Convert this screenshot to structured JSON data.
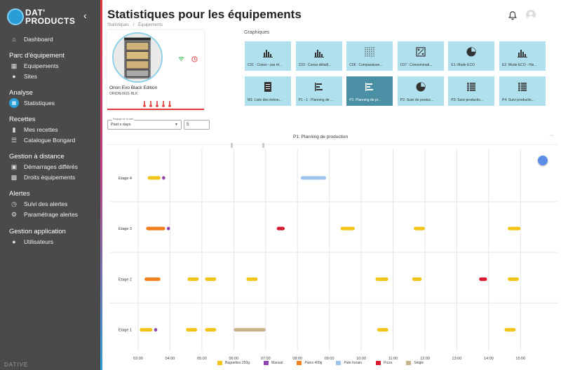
{
  "sidebar": {
    "logo_line1": "DAT'",
    "logo_line2": "PRODUCTS",
    "footer": "DATIVE",
    "sections": [
      {
        "label": "Parc d'équipement"
      },
      {
        "label": "Analyse"
      },
      {
        "label": "Recettes"
      },
      {
        "label": "Gestion à distance"
      },
      {
        "label": "Alertes"
      },
      {
        "label": "Gestion application"
      }
    ],
    "items": [
      {
        "label": "Dashboard",
        "icon": "home-icon"
      },
      {
        "label": "Equipements",
        "icon": "grid-icon"
      },
      {
        "label": "Sites",
        "icon": "map-pin-icon"
      },
      {
        "label": "Statistiques",
        "icon": "bar-chart-icon",
        "active": true
      },
      {
        "label": "Mes recettes",
        "icon": "book-icon"
      },
      {
        "label": "Catalogue Bongard",
        "icon": "list-icon"
      },
      {
        "label": "Démarrages différés",
        "icon": "calendar-icon"
      },
      {
        "label": "Droits équipements",
        "icon": "device-icon"
      },
      {
        "label": "Suivi des alertes",
        "icon": "clock-icon"
      },
      {
        "label": "Paramétrage alertes",
        "icon": "gear-icon"
      },
      {
        "label": "Utilisateurs",
        "icon": "users-icon"
      }
    ]
  },
  "header": {
    "title": "Statistiques pour les équipements",
    "breadcrumb": [
      "Statistiques",
      "Équipements"
    ],
    "breadcrumb_sep": "/"
  },
  "device": {
    "name": "Orion Evo Black Edition",
    "code": "ORION-6621-BLK",
    "temp_indicator_count": 5
  },
  "graphics": {
    "title": "Graphiques",
    "tiles": [
      {
        "label": "C01 : Conso - par ét...",
        "icon": "bar-chart-icon"
      },
      {
        "label": "C03 : Conso détaill...",
        "icon": "bar-chart-icon"
      },
      {
        "label": "C06 : Comparaison...",
        "icon": "dot-matrix-icon"
      },
      {
        "label": "C07 : Consommati...",
        "icon": "percent-icon"
      },
      {
        "label": "E1: Mode ECO",
        "icon": "pie-chart-icon"
      },
      {
        "label": "E2: Mode ECO - His...",
        "icon": "bar-chart-icon"
      },
      {
        "label": "M1: Liste des évène...",
        "icon": "document-icon"
      },
      {
        "label": "P1 - 1 : Planning de ...",
        "icon": "gantt-icon"
      },
      {
        "label": "P1: Planning de pr...",
        "icon": "gantt-icon",
        "selected": true
      },
      {
        "label": "P2: Suivi de produc...",
        "icon": "pie-chart-icon"
      },
      {
        "label": "P3: Suivi productio...",
        "icon": "table-icon"
      },
      {
        "label": "P4: Suivi productio...",
        "icon": "table-icon"
      }
    ]
  },
  "controls": {
    "period_caption": "Réglage de la date",
    "period_value": "Past x days",
    "days_value": "5"
  },
  "colors": {
    "sidebar_bg": "#4a4a4a",
    "accent_blue": "#2a9cd6",
    "tile_bg": "#b0e0ee",
    "tile_selected": "#4a8fa3",
    "alert_red": "#e2373c"
  },
  "chart_data": {
    "type": "gantt",
    "title": "P1: Planning de production",
    "x_ticks": [
      "03:00",
      "04:00",
      "05:00",
      "06:00",
      "07:00",
      "08:00",
      "09:00",
      "10:00",
      "11:00",
      "12:00",
      "13:00",
      "14:00",
      "15:00"
    ],
    "x_range": [
      3.0,
      15.5
    ],
    "rows": [
      "Etage 4",
      "Etage 3",
      "Etage 2",
      "Etage 1"
    ],
    "categories": [
      {
        "name": "Baguettes 250g",
        "color": "#f0c419"
      },
      {
        "name": "Manual",
        "color": "#8e44ad"
      },
      {
        "name": "Pains 400g",
        "color": "#f07f1e"
      },
      {
        "name": "Pate lorrain",
        "color": "#9dc3ee"
      },
      {
        "name": "Pizza",
        "color": "#d7192f"
      },
      {
        "name": "Seigle",
        "color": "#c8b48a"
      }
    ],
    "bars": [
      {
        "row": "Etage 4",
        "cat": "Baguettes 250g",
        "start": 3.3,
        "end": 3.7
      },
      {
        "row": "Etage 4",
        "cat": "Manual",
        "start": 3.75,
        "end": 3.85
      },
      {
        "row": "Etage 4",
        "cat": "Pate lorrain",
        "start": 8.1,
        "end": 8.9
      },
      {
        "row": "Etage 3",
        "cat": "Pains 400g",
        "start": 3.25,
        "end": 3.85
      },
      {
        "row": "Etage 3",
        "cat": "Manual",
        "start": 3.9,
        "end": 4.0
      },
      {
        "row": "Etage 3",
        "cat": "Pizza",
        "start": 7.35,
        "end": 7.6
      },
      {
        "row": "Etage 3",
        "cat": "Baguettes 250g",
        "start": 9.35,
        "end": 9.8
      },
      {
        "row": "Etage 3",
        "cat": "Baguettes 250g",
        "start": 11.65,
        "end": 12.0
      },
      {
        "row": "Etage 3",
        "cat": "Baguettes 250g",
        "start": 14.6,
        "end": 15.0
      },
      {
        "row": "Etage 2",
        "cat": "Pains 400g",
        "start": 3.2,
        "end": 3.7
      },
      {
        "row": "Etage 2",
        "cat": "Baguettes 250g",
        "start": 4.55,
        "end": 4.9
      },
      {
        "row": "Etage 2",
        "cat": "Baguettes 250g",
        "start": 5.1,
        "end": 5.45
      },
      {
        "row": "Etage 2",
        "cat": "Baguettes 250g",
        "start": 6.4,
        "end": 6.75
      },
      {
        "row": "Etage 2",
        "cat": "Baguettes 250g",
        "start": 10.45,
        "end": 10.85
      },
      {
        "row": "Etage 2",
        "cat": "Baguettes 250g",
        "start": 11.6,
        "end": 11.9
      },
      {
        "row": "Etage 2",
        "cat": "Pizza",
        "start": 13.7,
        "end": 13.95
      },
      {
        "row": "Etage 2",
        "cat": "Baguettes 250g",
        "start": 14.6,
        "end": 14.95
      },
      {
        "row": "Etage 1",
        "cat": "Baguettes 250g",
        "start": 3.05,
        "end": 3.45
      },
      {
        "row": "Etage 1",
        "cat": "Manual",
        "start": 3.5,
        "end": 3.6
      },
      {
        "row": "Etage 1",
        "cat": "Baguettes 250g",
        "start": 4.5,
        "end": 4.85
      },
      {
        "row": "Etage 1",
        "cat": "Baguettes 250g",
        "start": 5.1,
        "end": 5.45
      },
      {
        "row": "Etage 1",
        "cat": "Seigle",
        "start": 6.0,
        "end": 7.0
      },
      {
        "row": "Etage 1",
        "cat": "Baguettes 250g",
        "start": 10.5,
        "end": 10.85
      },
      {
        "row": "Etage 1",
        "cat": "Baguettes 250g",
        "start": 14.5,
        "end": 14.85
      }
    ],
    "grid": true,
    "legend_position": "bottom"
  }
}
